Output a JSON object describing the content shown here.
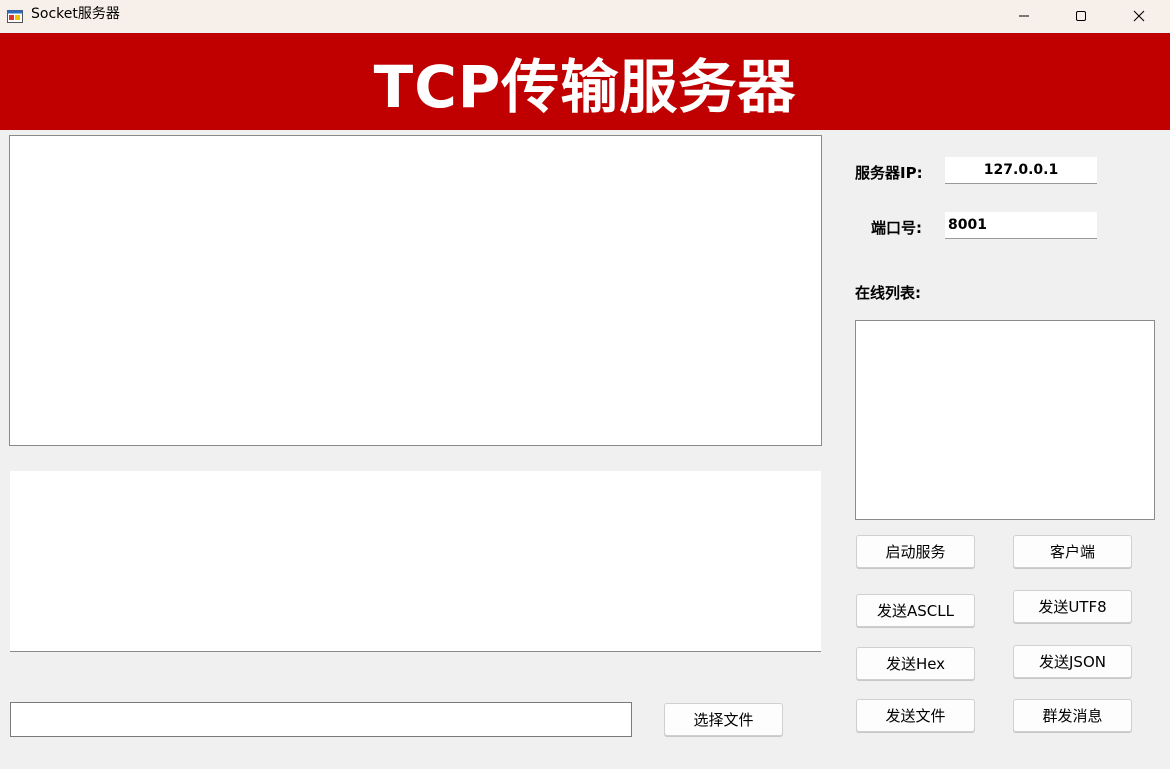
{
  "window": {
    "title": "Socket服务器"
  },
  "banner": {
    "title": "TCP传输服务器"
  },
  "server": {
    "ip_label": "服务器IP:",
    "ip_value": "127.0.0.1",
    "port_label": "端口号:",
    "port_value": "8001",
    "online_label": "在线列表:"
  },
  "buttons": {
    "choose_file": "选择文件",
    "start_service": "启动服务",
    "client": "客户端",
    "send_ascii": "发送ASCLL",
    "send_utf8": "发送UTF8",
    "send_hex": "发送Hex",
    "send_json": "发送JSON",
    "send_file": "发送文件",
    "broadcast": "群发消息"
  },
  "colors": {
    "banner_bg": "#c00000",
    "titlebar_bg": "#f7efea",
    "window_bg": "#f0f0f0"
  },
  "icons": {
    "app": "winforms-app-icon",
    "minimize": "minimize-icon",
    "maximize": "maximize-icon",
    "close": "close-icon"
  }
}
